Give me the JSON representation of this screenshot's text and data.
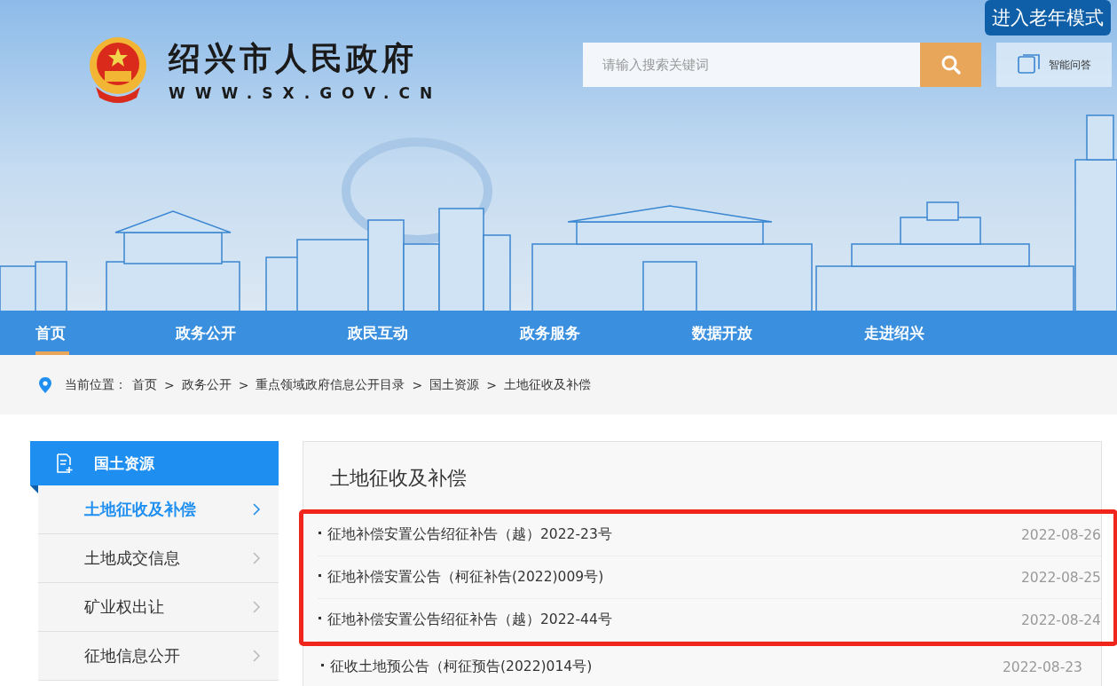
{
  "header": {
    "elder_mode_button": "进入老年模式",
    "site_name": "绍兴市人民政府",
    "site_url": "WWW.SX.GOV.CN",
    "search": {
      "placeholder": "请输入搜索关键词"
    },
    "assistant_button": "智能问答"
  },
  "nav": [
    {
      "label": "首页",
      "selected": true
    },
    {
      "label": "政务公开",
      "selected": false
    },
    {
      "label": "政民互动",
      "selected": false
    },
    {
      "label": "政务服务",
      "selected": false
    },
    {
      "label": "数据开放",
      "selected": false
    },
    {
      "label": "走进绍兴",
      "selected": false
    }
  ],
  "breadcrumb": {
    "label": "当前位置：",
    "items": [
      "首页",
      "政务公开",
      "重点领域政府信息公开目录",
      "国土资源",
      "土地征收及补偿"
    ],
    "separator": ">"
  },
  "sidebar": {
    "title": "国土资源",
    "items": [
      {
        "label": "土地征收及补偿",
        "selected": true
      },
      {
        "label": "土地成交信息",
        "selected": false
      },
      {
        "label": "矿业权出让",
        "selected": false
      },
      {
        "label": "征地信息公开",
        "selected": false
      }
    ]
  },
  "content": {
    "title": "土地征收及补偿",
    "rows": [
      {
        "title": "征地补偿安置公告绍征补告（越）2022-23号",
        "date": "2022-08-26",
        "highlighted": true
      },
      {
        "title": "征地补偿安置公告（柯征补告(2022)009号)",
        "date": "2022-08-25",
        "highlighted": true
      },
      {
        "title": "征地补偿安置公告绍征补告（越）2022-44号",
        "date": "2022-08-24",
        "highlighted": true
      },
      {
        "title": "征收土地预公告（柯征预告(2022)014号)",
        "date": "2022-08-23",
        "highlighted": false
      }
    ]
  }
}
